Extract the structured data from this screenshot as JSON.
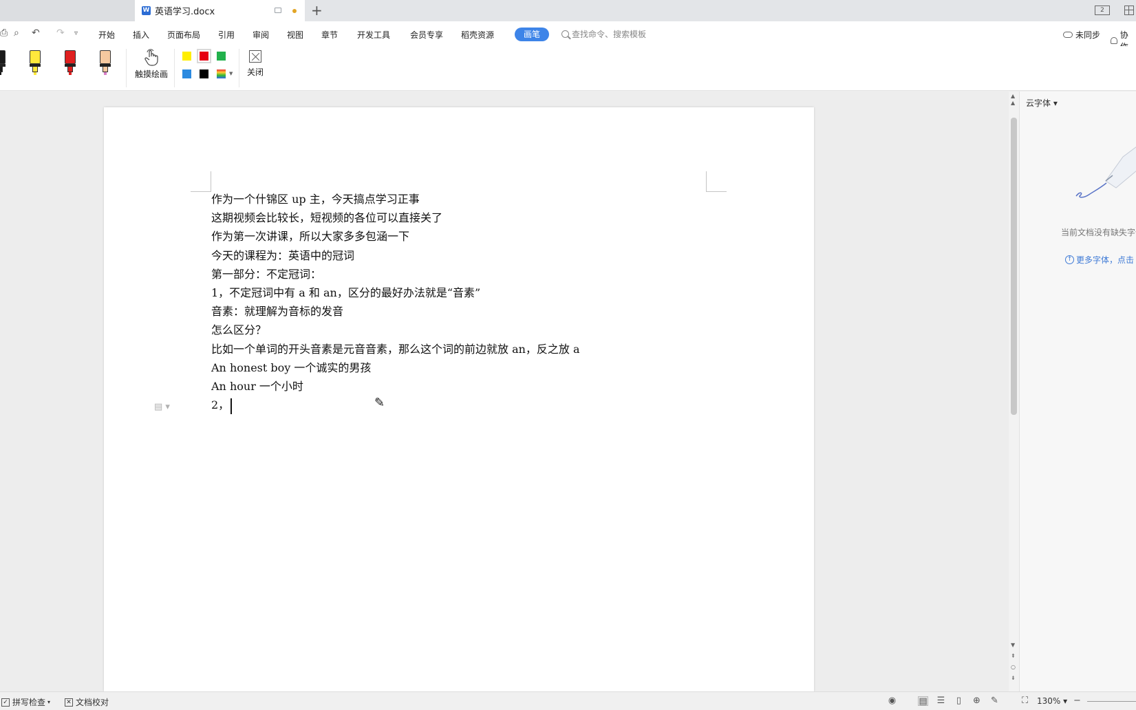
{
  "tabbar": {
    "doc_title": "英语学习.docx",
    "word_icon": "W",
    "new_tab_glyph": "+",
    "layout_icon_text": "2"
  },
  "menubar": {
    "items": [
      "开始",
      "插入",
      "页面布局",
      "引用",
      "审阅",
      "视图",
      "章节",
      "开发工具",
      "会员专享",
      "稻壳资源"
    ],
    "active_item": "画笔",
    "search_placeholder": "查找命令、搜索模板",
    "sync_label": "未同步",
    "collab_label": "协作"
  },
  "pen_toolbar": {
    "markers": [
      {
        "name": "black-pen",
        "body": "#1a1a1a",
        "nib": "#1a1a1a"
      },
      {
        "name": "yellow-highlighter",
        "body": "#ffe83c",
        "nib": "#ffe83c"
      },
      {
        "name": "red-pen",
        "body": "#e02020",
        "nib": "#e02020"
      },
      {
        "name": "eraser",
        "body": "#f5c9a0",
        "nib": "#d97fc7"
      }
    ],
    "touch_draw_label": "触摸绘画",
    "colors": [
      "#ffee00",
      "#e60012",
      "#22b14c",
      "#2b8ae0",
      "#000000"
    ],
    "selected_color": "#e60012",
    "close_label": "关闭"
  },
  "document": {
    "lines": [
      "作为一个什锦区 up 主，今天搞点学习正事",
      "这期视频会比较长，短视频的各位可以直接关了",
      "作为第一次讲课，所以大家多多包涵一下",
      "今天的课程为：英语中的冠词",
      "第一部分：不定冠词：",
      "1，不定冠词中有 a  和 an，区分的最好办法就是“音素”",
      "音素：就理解为音标的发音",
      "怎么区分？",
      "比如一个单词的开头音素是元音音素，那么这个词的前边就放 an，反之放 a",
      "An honest boy  一个诚实的男孩",
      "An hour 一个小时",
      "2，"
    ]
  },
  "right_panel": {
    "title": "云字体",
    "empty_message": "当前文档没有缺失字体",
    "more_fonts": "更多字体，点击"
  },
  "statusbar": {
    "spell_check": "拼写检查",
    "doc_proof": "文档校对",
    "zoom": "130%"
  },
  "colors": {
    "accent": "#3d84e8",
    "tabbar_bg": "#e3e5e8",
    "workspace_bg": "#ededed"
  }
}
